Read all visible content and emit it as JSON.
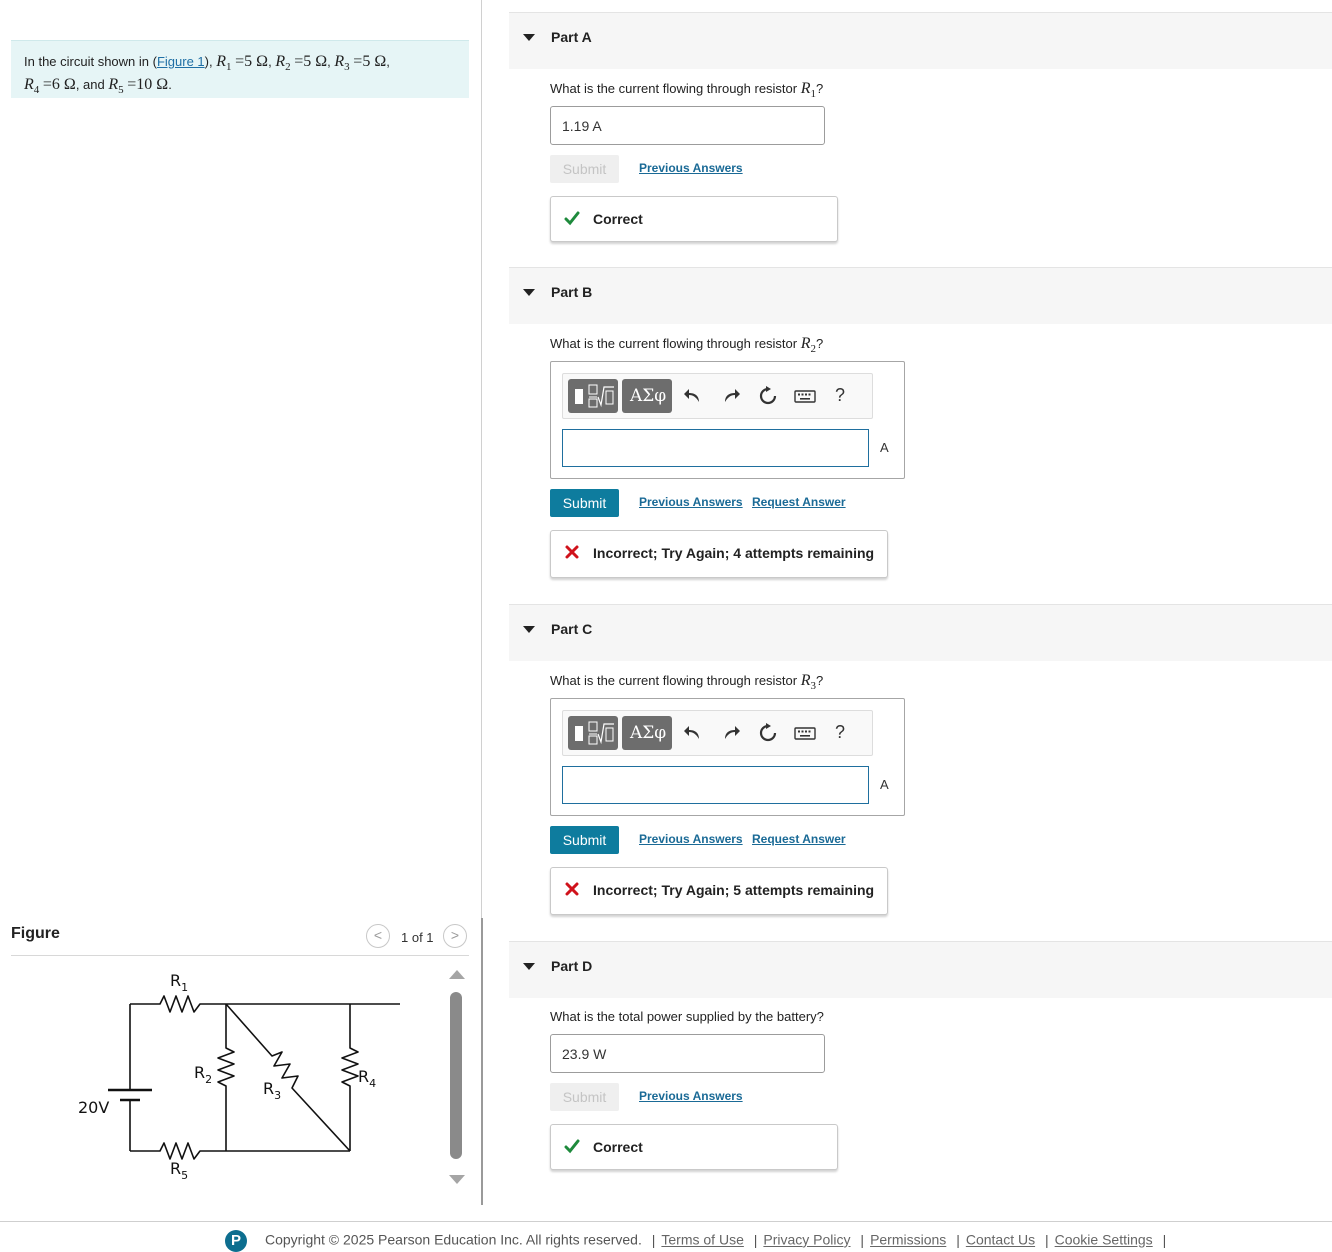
{
  "problem": {
    "intro": "In the circuit shown in (",
    "figure_link": "Figure 1",
    "close": "),",
    "r1_sym": "R",
    "r1_sub": "1",
    "r1_val": "=5 Ω",
    "r2_sym": "R",
    "r2_sub": "2",
    "r2_val": "=5 Ω",
    "r3_sym": "R",
    "r3_sub": "3",
    "r3_val": "=5 Ω",
    "r4_sym": "R",
    "r4_sub": "4",
    "r4_val": "=6 Ω",
    "and_text": ", and",
    "r5_sym": "R",
    "r5_sub": "5",
    "r5_val": "=10 Ω",
    "comma": ",",
    "period": "."
  },
  "figure": {
    "title": "Figure",
    "pager": "1 of 1",
    "prev_icon": "chevron-left-icon",
    "next_icon": "chevron-right-icon",
    "labels": {
      "r1": "R",
      "r1_sub": "1",
      "r2": "R",
      "r2_sub": "2",
      "r3": "R",
      "r3_sub": "3",
      "r4": "R",
      "r4_sub": "4",
      "r5": "R",
      "r5_sub": "5",
      "battery": "20V"
    }
  },
  "parts": {
    "a": {
      "title": "Part A",
      "question_prefix": "What is the current flowing through resistor ",
      "sym": "R",
      "sub": "1",
      "question_suffix": "?",
      "answer": "1.19  A",
      "submit": "Submit",
      "previous_answers": "Previous Answers",
      "feedback": "Correct",
      "status": "correct"
    },
    "b": {
      "title": "Part B",
      "question_prefix": "What is the current flowing through resistor ",
      "sym": "R",
      "sub": "2",
      "question_suffix": "?",
      "greek_button": "ΑΣφ",
      "help": "?",
      "unit": "A",
      "input_value": "",
      "submit": "Submit",
      "previous_answers": "Previous Answers",
      "request_answer": "Request Answer",
      "feedback": "Incorrect; Try Again; 4 attempts remaining",
      "status": "incorrect"
    },
    "c": {
      "title": "Part C",
      "question_prefix": "What is the current flowing through resistor ",
      "sym": "R",
      "sub": "3",
      "question_suffix": "?",
      "greek_button": "ΑΣφ",
      "help": "?",
      "unit": "A",
      "input_value": "",
      "submit": "Submit",
      "previous_answers": "Previous Answers",
      "request_answer": "Request Answer",
      "feedback": "Incorrect; Try Again; 5 attempts remaining",
      "status": "incorrect"
    },
    "d": {
      "title": "Part D",
      "question": "What is the total power supplied by the battery?",
      "answer": "23.9  W",
      "submit": "Submit",
      "previous_answers": "Previous Answers",
      "feedback": "Correct",
      "status": "correct"
    }
  },
  "footer": {
    "logo": "P",
    "copyright": "Copyright © 2025  Pearson Education Inc. All rights reserved.",
    "links": [
      "Terms of Use",
      "Privacy Policy",
      "Permissions",
      "Contact Us",
      "Cookie Settings"
    ]
  },
  "colors": {
    "accent": "#0e7c9e",
    "link": "#1a6a96",
    "correct": "#1e8a3c",
    "incorrect": "#d0121b",
    "problem_bg": "#e6f5f6"
  }
}
